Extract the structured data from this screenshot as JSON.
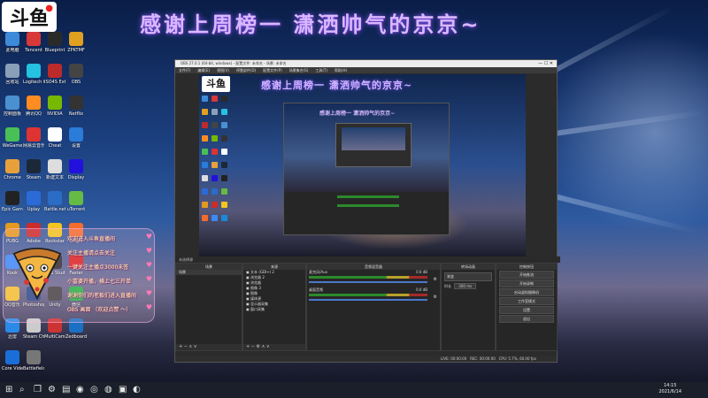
{
  "overlay": {
    "title": "感谢上周榜一 潇洒帅气的京京~",
    "logo_text": "斗鱼"
  },
  "desktop_icons": [
    {
      "label": "此电脑",
      "color": "#3c8ad8"
    },
    {
      "label": "Tencent",
      "color": "#d93838"
    },
    {
      "label": "Blueprint",
      "color": "#2a2a2a"
    },
    {
      "label": "ZPKTMF",
      "color": "#e0a020"
    },
    {
      "label": "回收站",
      "color": "#8aa0b8"
    },
    {
      "label": "Logitech G HUB",
      "color": "#25c1e0"
    },
    {
      "label": "ISO4S Extreme",
      "color": "#bb2b2b"
    },
    {
      "label": "OBS",
      "color": "#444"
    },
    {
      "label": "控制面板",
      "color": "#4a90d0"
    },
    {
      "label": "腾讯QQ",
      "color": "#ff8c20"
    },
    {
      "label": "NVIDIA",
      "color": "#76b900"
    },
    {
      "label": "Netflix",
      "color": "#333"
    },
    {
      "label": "WeGame",
      "color": "#49c055"
    },
    {
      "label": "网易云音乐",
      "color": "#d33"
    },
    {
      "label": "Cheat",
      "color": "#fff"
    },
    {
      "label": "设置",
      "color": "#2b7bd8"
    },
    {
      "label": "Chrome",
      "color": "#e8a13a"
    },
    {
      "label": "Steam",
      "color": "#1b2838"
    },
    {
      "label": "新建文本",
      "color": "#ddd"
    },
    {
      "label": "Display",
      "color": "#21d"
    },
    {
      "label": "Epic Games",
      "color": "#222"
    },
    {
      "label": "Uplay",
      "color": "#2a6bd8"
    },
    {
      "label": "Battle.net",
      "color": "#2b6cc4"
    },
    {
      "label": "uTorrent",
      "color": "#6b4"
    },
    {
      "label": "PUBG",
      "color": "#e39a1f"
    },
    {
      "label": "Adobe",
      "color": "#cc2c2c"
    },
    {
      "label": "Rockstar",
      "color": "#f3c521"
    },
    {
      "label": "Origin",
      "color": "#f56c2d"
    },
    {
      "label": "Kook",
      "color": "#3b8af6"
    },
    {
      "label": "迅雷",
      "color": "#1a8ad8"
    },
    {
      "label": "OBS Studio",
      "color": "#302e31"
    },
    {
      "label": "Faster",
      "color": "#d22"
    },
    {
      "label": "QQ音乐",
      "color": "#f2c230"
    },
    {
      "label": "Photoshop",
      "color": "#2b4a8a"
    },
    {
      "label": "Unity",
      "color": "#444"
    },
    {
      "label": "微信",
      "color": "#27b541"
    },
    {
      "label": "迅雷",
      "color": "#2a8ae8"
    },
    {
      "label": "Steam Cheat",
      "color": "#ccc"
    },
    {
      "label": "MultiCam Capture Lite",
      "color": "#c33"
    },
    {
      "label": "Zedboard",
      "color": "#1b70c4"
    },
    {
      "label": "Core VideoStud",
      "color": "#1a6ed8"
    },
    {
      "label": "Battlefield 1",
      "color": "#777"
    }
  ],
  "chat": {
    "messages": [
      "欢迎进入斗鱼直播间",
      "关注主播请点击关注",
      "一键关注主播点3000未签",
      "小富婆开播，横上七三开单",
      "谢谢你们的老板们进入直播间",
      "OBS 画面 （欢迎点赞 ～）"
    ]
  },
  "obs": {
    "window_title": "OBS 27.0.1 (64-bit, windows) - 配置文件: 未命名 - 场景: 未命名",
    "menu": [
      "文件(F)",
      "编辑(E)",
      "视图(V)",
      "停靠部件(D)",
      "配置文件(P)",
      "场景集合(S)",
      "工具(T)",
      "帮助(H)"
    ],
    "preview_title": "感谢上周榜一 潇洒帅气的京京~",
    "nested_title": "感谢上周榜一 潇洒帅气的京京~",
    "panels": {
      "scenes": {
        "title": "场景",
        "items": [
          "场景"
        ]
      },
      "sources": {
        "title": "来源",
        "items": [
          "文本 (GDI+) 2",
          "浏览器 2",
          "浏览器",
          "图像 3",
          "图像",
          "媒体源",
          "显示器采集",
          "窗口采集"
        ]
      },
      "mixer": {
        "title": "音频混音器",
        "channels": [
          {
            "name": "麦克风/Aux",
            "db": "0.0 dB"
          },
          {
            "name": "桌面音频",
            "db": "0.0 dB"
          }
        ]
      },
      "transitions": {
        "title": "转场动画",
        "type": "渐变",
        "duration_label": "时长",
        "duration": "300 ms"
      },
      "controls": {
        "title": "控制按钮",
        "buttons": [
          "开始推流",
          "开始录制",
          "启动虚拟摄像机",
          "工作室模式",
          "设置",
          "退出"
        ]
      }
    },
    "status": {
      "live": "LIVE: 00:00:00",
      "rec": "REC: 00:00:00",
      "cpu": "CPU: 5.7%, 60.00 fps"
    },
    "bottom_bar_label": "未选择源"
  },
  "taskbar": {
    "time": "14:15",
    "date": "2021/6/14",
    "icons": [
      "windows-icon",
      "search-icon",
      "task-view-icon",
      "settings-icon",
      "file-explorer-icon",
      "chrome-icon",
      "obs-icon",
      "steam-icon",
      "folder-icon",
      "edge-icon"
    ]
  }
}
